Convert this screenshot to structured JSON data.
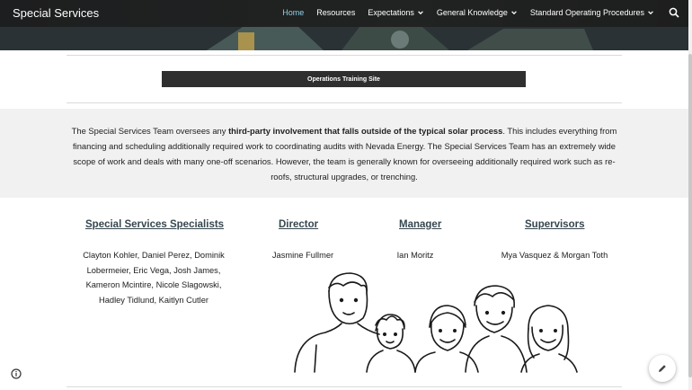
{
  "header": {
    "site_title": "Special Services",
    "nav": [
      {
        "label": "Home",
        "active": true,
        "dropdown": false
      },
      {
        "label": "Resources",
        "active": false,
        "dropdown": false
      },
      {
        "label": "Expectations",
        "active": false,
        "dropdown": true
      },
      {
        "label": "General Knowledge",
        "active": false,
        "dropdown": true
      },
      {
        "label": "Standard Operating Procedures",
        "active": false,
        "dropdown": true
      }
    ],
    "search_icon": "search-icon"
  },
  "main": {
    "ops_button_label": "Operations Training Site",
    "intro": {
      "before": "The Special Services Team oversees any ",
      "bold": "third-party involvement that falls outside of the typical solar process",
      "after": ". This includes everything from financing and scheduling additionally required work to coordinating audits with Nevada Energy. The Special Services Team has an extremely wide scope of work and deals with many one-off scenarios. However, the team is generally known for overseeing additionally required work such as re-roofs, structural upgrades, or trenching."
    },
    "columns": {
      "specialists": {
        "heading": "Special Services Specialists",
        "lines": [
          "Clayton Kohler, Daniel Perez, Dominik",
          "Lobermeier, Eric Vega, Josh James,",
          "Kameron Mcintire, Nicole Slagowski,",
          "Hadley Tidlund, Kaitlyn Cutler"
        ]
      },
      "director": {
        "heading": "Director",
        "names": "Jasmine Fullmer"
      },
      "manager": {
        "heading": "Manager",
        "names": "Ian Moritz"
      },
      "supervisors": {
        "heading": "Supervisors",
        "names": "Mya Vasquez & Morgan Toth"
      }
    }
  },
  "footer": {
    "info_icon": "info-icon",
    "edit_icon": "pencil-icon"
  },
  "colors": {
    "active_nav": "#8fd0e6",
    "topbar": "#1e1e1e",
    "button": "#2f2f2f",
    "heading": "#37474f"
  }
}
